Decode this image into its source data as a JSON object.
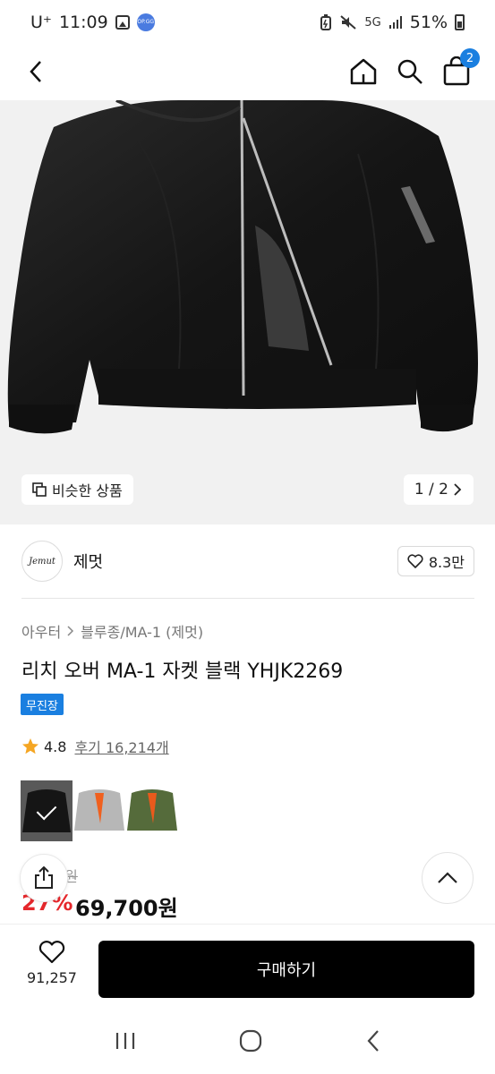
{
  "status_bar": {
    "carrier": "U⁺",
    "time": "11:09",
    "opgg": "OP.GG",
    "network": "5G",
    "battery": "51%"
  },
  "header": {
    "cart_count": "2"
  },
  "hero": {
    "similar_label": "비슷한 상품",
    "page_indicator": "1 / 2"
  },
  "brand": {
    "logo_text": "Jemut",
    "name": "제멋",
    "likes": "8.3만"
  },
  "product": {
    "breadcrumb": [
      "아우터",
      "블루종/MA-1 (제멋)"
    ],
    "title": "리치 오버 MA-1 자켓 블랙 YHJK2269",
    "tag": "무진장",
    "rating": "4.8",
    "reviews": "후기 16,214개",
    "colors": [
      {
        "name": "black",
        "body": "#1c1c1c",
        "lining": "#2a2a2a",
        "selected": true
      },
      {
        "name": "gray",
        "body": "#b7b7b7",
        "lining": "#f0601e",
        "selected": false
      },
      {
        "name": "olive",
        "body": "#556b3b",
        "lining": "#ea5a1c",
        "selected": false
      }
    ],
    "original_price": "9원",
    "discount": "27%",
    "price": "69,700원"
  },
  "bottom_bar": {
    "wish_count": "91,257",
    "buy_label": "구매하기"
  },
  "nav_bar": {
    "recent": "recent-apps-icon",
    "home": "home-circle-icon",
    "back": "back-icon"
  }
}
